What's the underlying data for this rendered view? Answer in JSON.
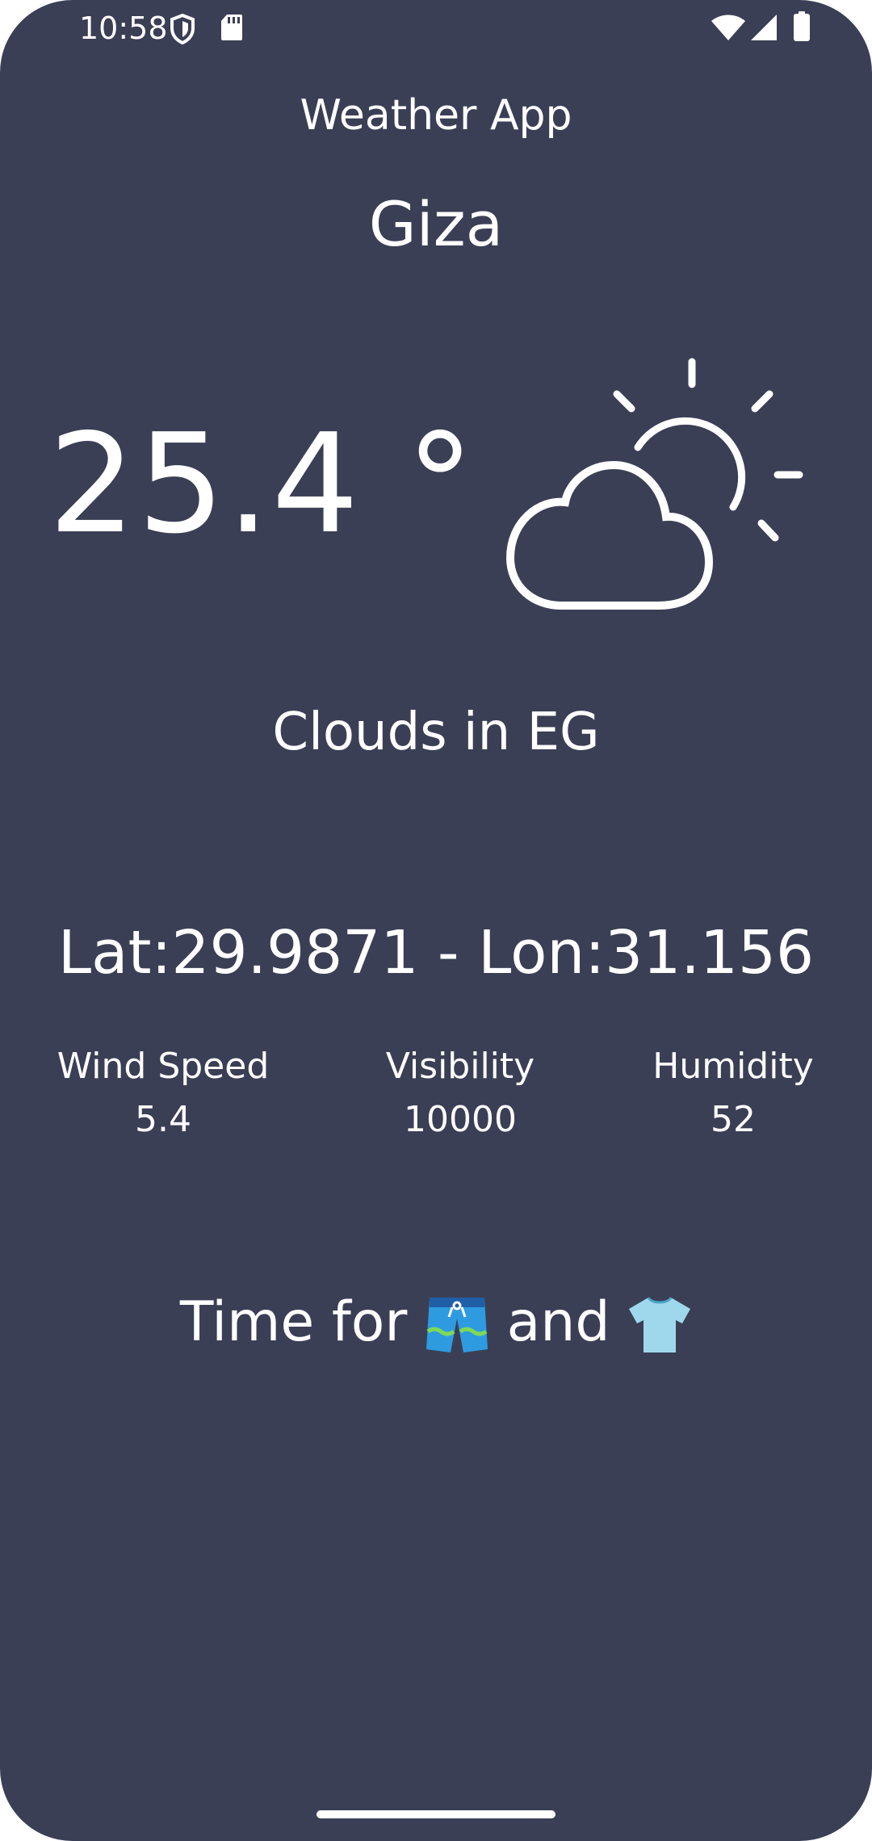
{
  "status_bar": {
    "time": "10:58",
    "icons": [
      "shield-icon",
      "sd-card-icon",
      "wifi-icon",
      "signal-icon",
      "battery-icon"
    ]
  },
  "app": {
    "title": "Weather App"
  },
  "weather": {
    "city": "Giza",
    "temperature": "25.4 °",
    "icon": "partly-cloudy-icon",
    "condition": "Clouds in EG",
    "coordinates": "Lat:29.9871 - Lon:31.156"
  },
  "stats": {
    "wind_label": "Wind Speed",
    "wind_value": "5.4",
    "visibility_label": "Visibility",
    "visibility_value": "10000",
    "humidity_label": "Humidity",
    "humidity_value": "52"
  },
  "advice": {
    "text_before": "Time for ",
    "text_middle": " and ",
    "icons": [
      "shorts-icon",
      "tshirt-icon"
    ]
  },
  "colors": {
    "background": "#3b3f55",
    "text": "#ffffff"
  }
}
